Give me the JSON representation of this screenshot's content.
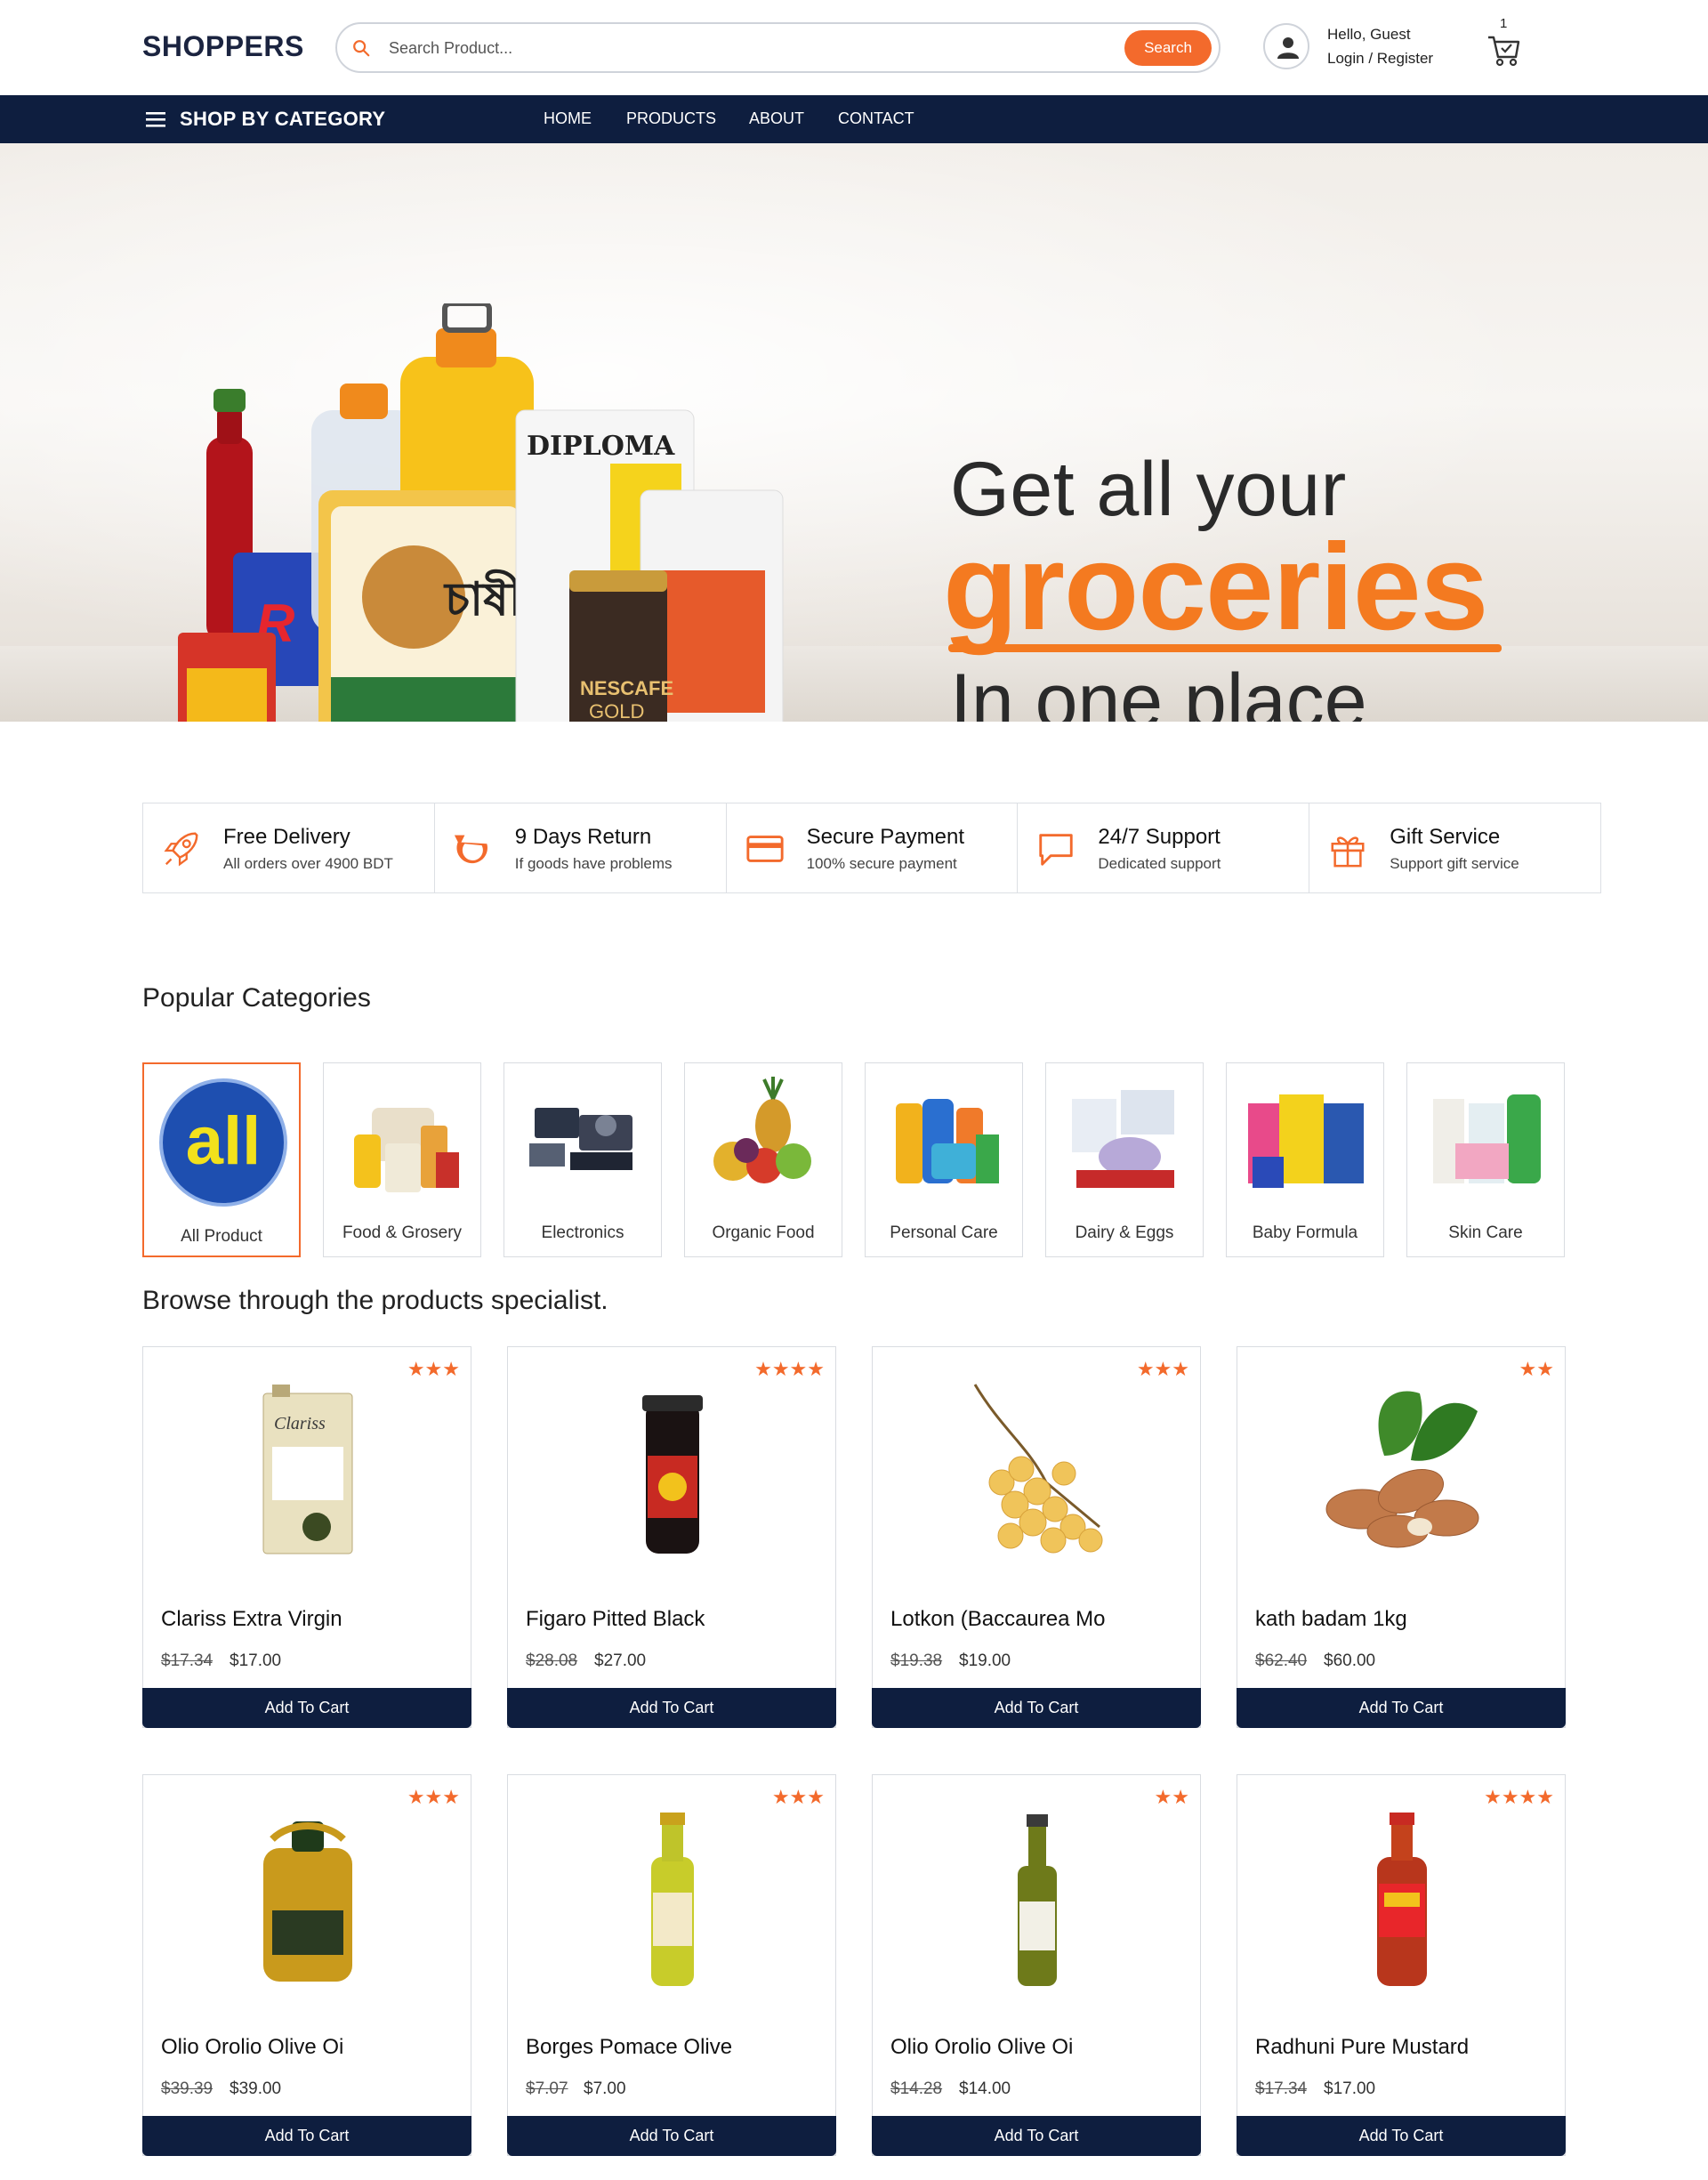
{
  "brand": "SHOPPERS",
  "search": {
    "placeholder": "Search Product...",
    "button": "Search"
  },
  "user": {
    "greeting": "Hello, Guest",
    "login": "Login / Register"
  },
  "cart": {
    "count": "1"
  },
  "nav": {
    "category_menu": "SHOP BY CATEGORY",
    "links": [
      "HOME",
      "PRODUCTS",
      "ABOUT",
      "CONTACT"
    ]
  },
  "hero": {
    "line1": "Get all your",
    "line2": "groceries",
    "line3": "In one place"
  },
  "features": [
    {
      "title": "Free Delivery",
      "subtitle": "All orders over 4900 BDT",
      "icon": "rocket-icon"
    },
    {
      "title": "9 Days Return",
      "subtitle": "If goods have problems",
      "icon": "return-arrow-icon"
    },
    {
      "title": "Secure Payment",
      "subtitle": "100% secure payment",
      "icon": "credit-card-icon"
    },
    {
      "title": "24/7 Support",
      "subtitle": "Dedicated support",
      "icon": "chat-bubble-icon"
    },
    {
      "title": "Gift Service",
      "subtitle": "Support gift service",
      "icon": "gift-icon"
    }
  ],
  "categories_title": "Popular Categories",
  "categories": [
    {
      "label": "All Product",
      "active": true
    },
    {
      "label": "Food & Grosery",
      "active": false
    },
    {
      "label": "Electronics",
      "active": false
    },
    {
      "label": "Organic Food",
      "active": false
    },
    {
      "label": "Personal Care",
      "active": false
    },
    {
      "label": "Dairy & Eggs",
      "active": false
    },
    {
      "label": "Baby Formula",
      "active": false
    },
    {
      "label": "Skin Care",
      "active": false
    }
  ],
  "category_logo_text": "all",
  "products_title": "Browse through the products specialist.",
  "add_to_cart": "Add To Cart",
  "products": [
    {
      "name": "Clariss Extra Virgin",
      "old_price": "$17.34",
      "price": "$17.00",
      "rating": 3
    },
    {
      "name": "Figaro Pitted Black",
      "old_price": "$28.08",
      "price": "$27.00",
      "rating": 4
    },
    {
      "name": "Lotkon (Baccaurea Mo",
      "old_price": "$19.38",
      "price": "$19.00",
      "rating": 3
    },
    {
      "name": "kath badam 1kg",
      "old_price": "$62.40",
      "price": "$60.00",
      "rating": 2
    },
    {
      "name": "Olio Orolio Olive Oi",
      "old_price": "$39.39",
      "price": "$39.00",
      "rating": 3
    },
    {
      "name": "Borges Pomace Olive",
      "old_price": "$7.07",
      "price": "$7.00",
      "rating": 3
    },
    {
      "name": "Olio Orolio Olive Oi",
      "old_price": "$14.28",
      "price": "$14.00",
      "rating": 2
    },
    {
      "name": "Radhuni Pure Mustard",
      "old_price": "$17.34",
      "price": "$17.00",
      "rating": 4
    }
  ],
  "colors": {
    "accent": "#f36a2c",
    "navy": "#0e1e3f",
    "hero_orange": "#f47a20"
  }
}
